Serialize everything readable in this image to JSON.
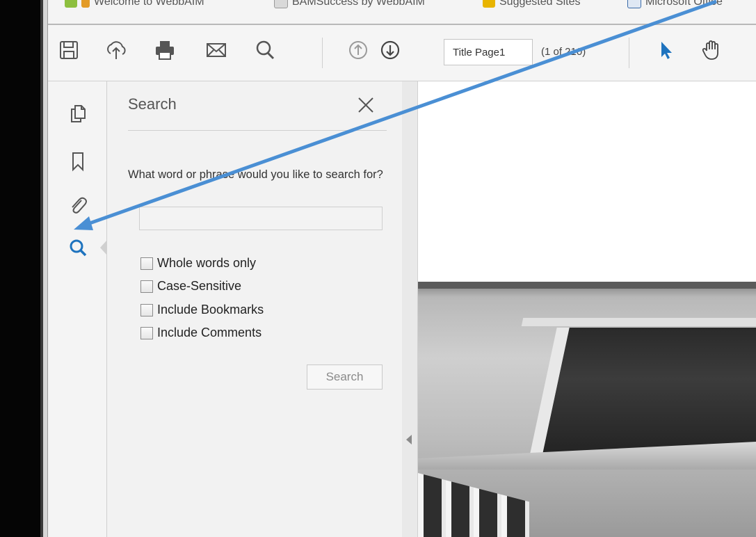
{
  "favorites_bar": {
    "items": [
      {
        "label": "Welcome to WebbAIM",
        "icon": "webaim-favicon"
      },
      {
        "label": "BAMSuccess by WebbAIM",
        "icon": "page-favicon"
      },
      {
        "label": "Suggested Sites",
        "icon": "suggested-sites-favicon"
      },
      {
        "label": "Microsoft Office",
        "icon": "office-favicon"
      }
    ]
  },
  "toolbar": {
    "icons": [
      "save-icon",
      "upload-icon",
      "print-icon",
      "email-icon",
      "search-icon",
      "previous-page-icon",
      "next-page-icon",
      "select-tool-icon",
      "hand-tool-icon"
    ],
    "page_label": "Title Page1",
    "page_count": "(1 of 210)"
  },
  "nav_panel": {
    "icons": [
      "pages-icon",
      "bookmark-icon",
      "attachment-icon",
      "search-icon"
    ],
    "active": "search-icon",
    "accent_color": "#1e73be"
  },
  "search_panel": {
    "title": "Search",
    "prompt": "What word or phrase would you like to search for?",
    "query": "",
    "options": [
      {
        "label": "Whole words only",
        "checked": false
      },
      {
        "label": "Case-Sensitive",
        "checked": false
      },
      {
        "label": "Include Bookmarks",
        "checked": false
      },
      {
        "label": "Include Comments",
        "checked": false
      }
    ],
    "search_button": "Search"
  },
  "annotation": {
    "color": "#4a8fd4"
  }
}
